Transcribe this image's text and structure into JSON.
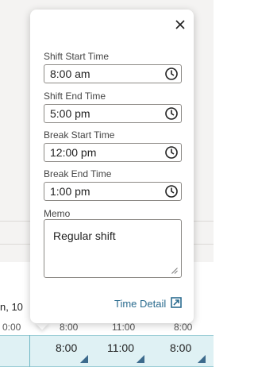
{
  "background": {
    "date_label": "n, 10",
    "ticks": [
      "0:00",
      "8:00",
      "11:00",
      "8:00"
    ],
    "cells": [
      "8:00",
      "11:00",
      "8:00"
    ]
  },
  "popup": {
    "close_icon": "close-icon",
    "fields": {
      "shift_start": {
        "label": "Shift Start Time",
        "value": "8:00 am"
      },
      "shift_end": {
        "label": "Shift End Time",
        "value": "5:00 pm"
      },
      "break_start": {
        "label": "Break Start Time",
        "value": "12:00 pm"
      },
      "break_end": {
        "label": "Break End Time",
        "value": "1:00 pm"
      }
    },
    "memo": {
      "label": "Memo",
      "value": "Regular shift"
    },
    "time_detail": {
      "label": "Time Detail",
      "icon": "external-link-icon"
    }
  },
  "colors": {
    "link": "#2b6c8f",
    "row_bg": "#dff1f4",
    "corner": "#3c6a8c"
  }
}
